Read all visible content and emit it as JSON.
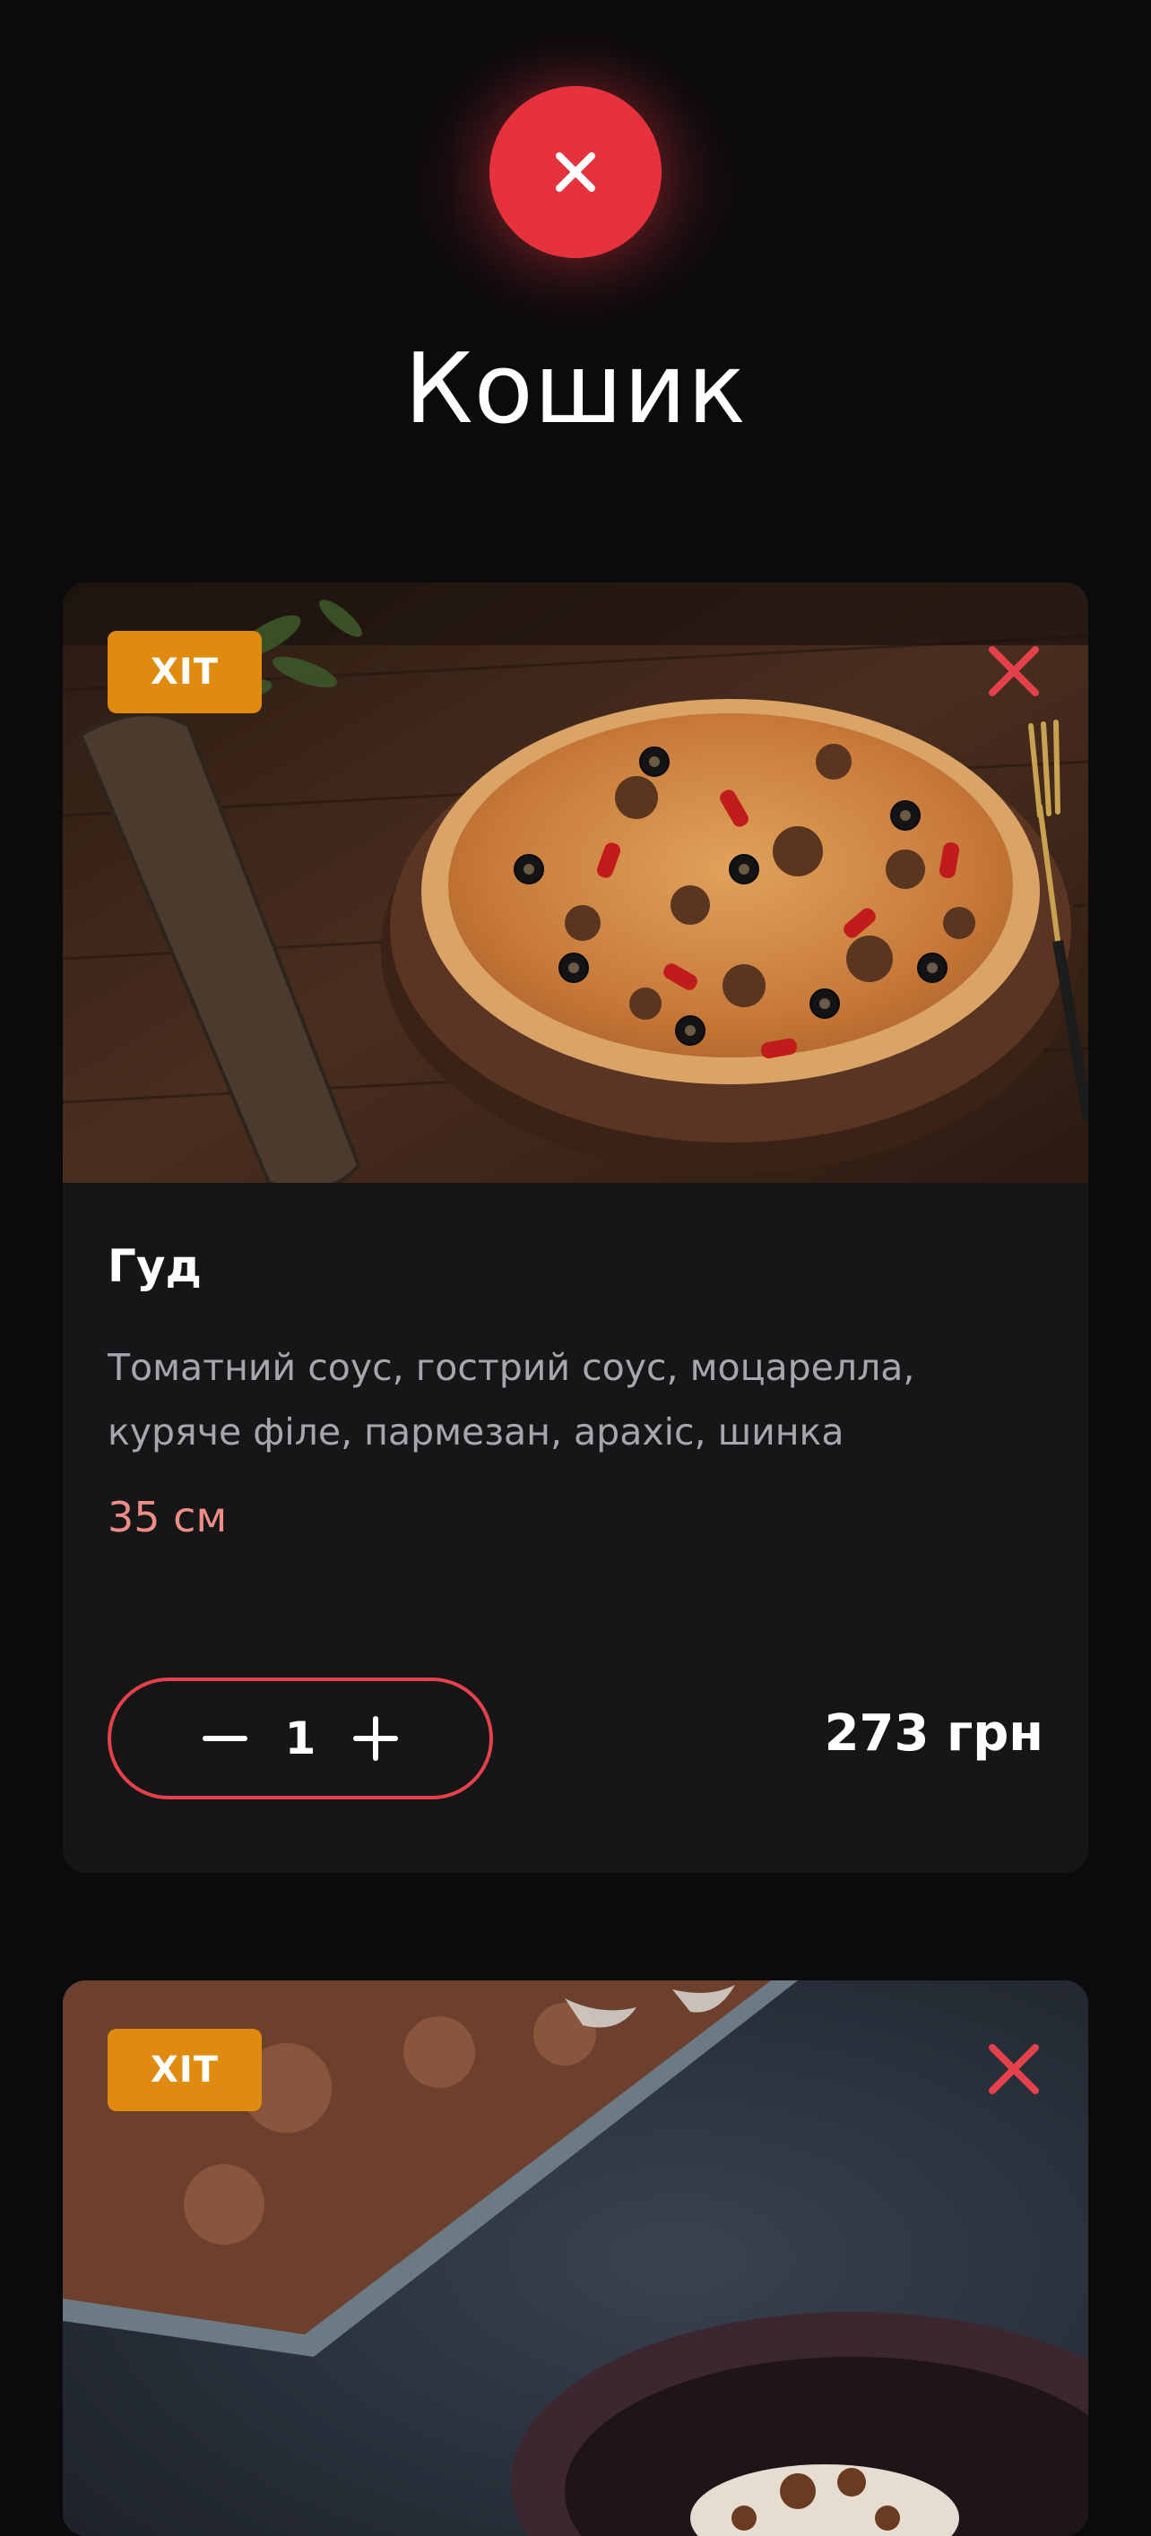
{
  "header": {
    "title": "Кошик",
    "close_icon": "close-icon"
  },
  "colors": {
    "accent": "#e5323d",
    "badge": "#e08a0f",
    "card_bg": "#161618",
    "size_text": "#ee8d84"
  },
  "cart": {
    "items": [
      {
        "badge": "ХІТ",
        "name": "Гуд",
        "description": "Томатний соус, гострий соус, моцарелла, куряче філе, пармезан, арахіс, шинка",
        "size": "35 см",
        "quantity": "1",
        "price": "273 грн",
        "image": "pizza-photo"
      },
      {
        "badge": "ХІТ",
        "image": "tiramisu-photo"
      }
    ]
  }
}
